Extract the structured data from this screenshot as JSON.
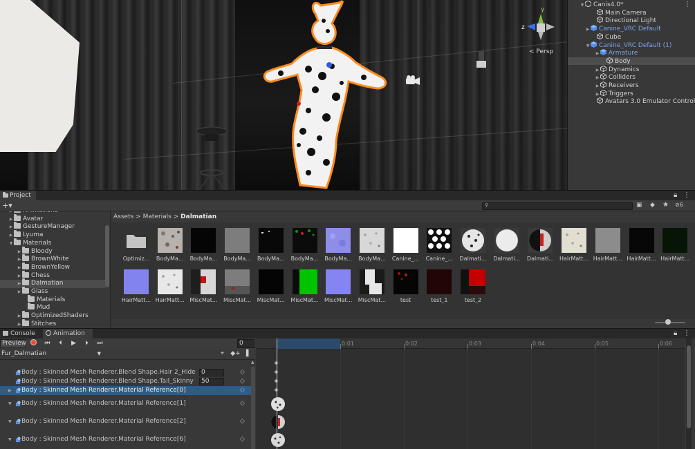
{
  "scene": {
    "persp_label": "< Persp",
    "gizmo_axes": {
      "y": "y",
      "z": "z"
    }
  },
  "hierarchy": {
    "items": [
      {
        "label": "Canis4.0*",
        "icon": "unity-scene-icon",
        "expanded": true
      },
      {
        "label": "Main Camera",
        "icon": "gameobject-icon"
      },
      {
        "label": "Directional Light",
        "icon": "gameobject-icon"
      },
      {
        "label": "Canine_VRC Default",
        "icon": "prefab-icon",
        "collapsed": true
      },
      {
        "label": "Cube",
        "icon": "gameobject-icon"
      },
      {
        "label": "Canine_VRC Default (1)",
        "icon": "prefab-icon",
        "expanded": true
      },
      {
        "label": "Armature",
        "icon": "prefab-icon",
        "collapsed": true
      },
      {
        "label": "Body",
        "icon": "gameobject-icon",
        "selected": true
      },
      {
        "label": "Dynamics",
        "icon": "gameobject-icon",
        "collapsed": true
      },
      {
        "label": "Colliders",
        "icon": "gameobject-icon",
        "collapsed": true
      },
      {
        "label": "Receivers",
        "icon": "gameobject-icon",
        "collapsed": true
      },
      {
        "label": "Triggers",
        "icon": "gameobject-icon",
        "collapsed": true
      },
      {
        "label": "Avatars 3.0 Emulator Control",
        "icon": "gameobject-icon"
      }
    ]
  },
  "project": {
    "tab_label": "Project",
    "add_label": "+▾",
    "hidden_count": "6",
    "breadcrumb": {
      "root": "Assets",
      "sep": ">",
      "mid": "Materials",
      "current": "Dalmatian"
    },
    "folders": [
      {
        "label": "Animations",
        "arrow": "▶"
      },
      {
        "label": "Avatar",
        "arrow": "▶"
      },
      {
        "label": "GestureManager",
        "arrow": "▶"
      },
      {
        "label": "Lyuma",
        "arrow": "▶"
      },
      {
        "label": "Materials",
        "arrow": "▼"
      },
      {
        "label": "Bloody",
        "arrow": "▶"
      },
      {
        "label": "BrownWhite",
        "arrow": "▶"
      },
      {
        "label": "BrownYellow",
        "arrow": "▶"
      },
      {
        "label": "Chess",
        "arrow": "▶"
      },
      {
        "label": "Dalmatian",
        "arrow": "▶",
        "selected": true
      },
      {
        "label": "Glass",
        "arrow": "▶"
      },
      {
        "label": "Materials",
        "arrow": ""
      },
      {
        "label": "Mud",
        "arrow": ""
      },
      {
        "label": "OptimizedShaders",
        "arrow": "▶"
      },
      {
        "label": "Stitches",
        "arrow": "▶"
      }
    ],
    "assets_row1": [
      {
        "label": "Optimiz...",
        "kind": "folder"
      },
      {
        "label": "BodyMa...",
        "kind": "noise",
        "color": "#b9b2ac"
      },
      {
        "label": "BodyMa...",
        "kind": "solid",
        "color": "#050505"
      },
      {
        "label": "BodyMa...",
        "kind": "solid",
        "color": "#7d7d7d"
      },
      {
        "label": "BodyMa...",
        "kind": "dots",
        "color": "#080808"
      },
      {
        "label": "BodyMa...",
        "kind": "green-noise",
        "color": "#0b0b0b"
      },
      {
        "label": "BodyMa...",
        "kind": "normal",
        "color": "#8e8ee8"
      },
      {
        "label": "BodyMa...",
        "kind": "light-noise",
        "color": "#d8d8d8"
      },
      {
        "label": "Canine_...",
        "kind": "solid",
        "color": "#ffffff"
      },
      {
        "label": "Canine_...",
        "kind": "hearts",
        "color": "#ffffff"
      },
      {
        "label": "Dalmati...",
        "kind": "sphere-spots",
        "color": "#e6e6e6"
      },
      {
        "label": "Dalmati...",
        "kind": "sphere-white",
        "color": "#ececec"
      },
      {
        "label": "Dalmati...",
        "kind": "sphere-red",
        "color": "#d0d0d0"
      },
      {
        "label": "HairMatt...",
        "kind": "light-noise",
        "color": "#e2dfd0"
      },
      {
        "label": "HairMatt...",
        "kind": "solid",
        "color": "#8c8c8c"
      },
      {
        "label": "HairMatt...",
        "kind": "solid",
        "color": "#070707"
      },
      {
        "label": "HairMatt...",
        "kind": "solid",
        "color": "#071507"
      }
    ],
    "assets_row2": [
      {
        "label": "HairMatt...",
        "kind": "solid",
        "color": "#8383f0"
      },
      {
        "label": "HairMatt...",
        "kind": "light-noise",
        "color": "#e8e8e8"
      },
      {
        "label": "MiscMat...",
        "kind": "misc-red",
        "color": "#d8d8d8"
      },
      {
        "label": "MiscMat...",
        "kind": "misc-grey",
        "color": "#7d7d7d"
      },
      {
        "label": "MiscMat...",
        "kind": "solid",
        "color": "#040404"
      },
      {
        "label": "MiscMat...",
        "kind": "misc-green",
        "color": "#00c400"
      },
      {
        "label": "MiscMat...",
        "kind": "solid",
        "color": "#8484f2"
      },
      {
        "label": "MiscMat...",
        "kind": "misc-white",
        "color": "#1a1a1a"
      },
      {
        "label": "test",
        "kind": "red-dots",
        "color": "#050505"
      },
      {
        "label": "test_1",
        "kind": "solid",
        "color": "#220606"
      },
      {
        "label": "test_2",
        "kind": "red-block",
        "color": "#c40000"
      }
    ]
  },
  "animation": {
    "console_tab": "Console",
    "animation_tab": "Animation",
    "preview_label": "Preview",
    "frame_value": "0",
    "clip_name": "Fur_Dalmatian",
    "properties": [
      {
        "label": "Body : Skinned Mesh Renderer.Blend Shape.Hair 2_Hide",
        "value": "0",
        "arrow": ""
      },
      {
        "label": "Body : Skinned Mesh Renderer.Blend Shape.Tail_Skinny",
        "value": "50",
        "arrow": ""
      },
      {
        "label": "Body : Skinned Mesh Renderer.Material Reference[0]",
        "value": "",
        "arrow": "▶",
        "selected": true
      },
      {
        "label": "Body : Skinned Mesh Renderer.Material Reference[1]",
        "value": "",
        "arrow": "▼"
      },
      {
        "label": "Body : Skinned Mesh Renderer.Material Reference[2]",
        "value": "",
        "arrow": "▼"
      },
      {
        "label": "Body : Skinned Mesh Renderer.Material Reference[6]",
        "value": "",
        "arrow": "▼"
      }
    ],
    "key_glyph": "◇",
    "ruler_ticks": [
      "0:00",
      "0:01",
      "0:02",
      "0:03",
      "0:04",
      "0:05",
      "0:06"
    ],
    "accent_color": "#2c5d87",
    "record_color": "#e0503a"
  }
}
